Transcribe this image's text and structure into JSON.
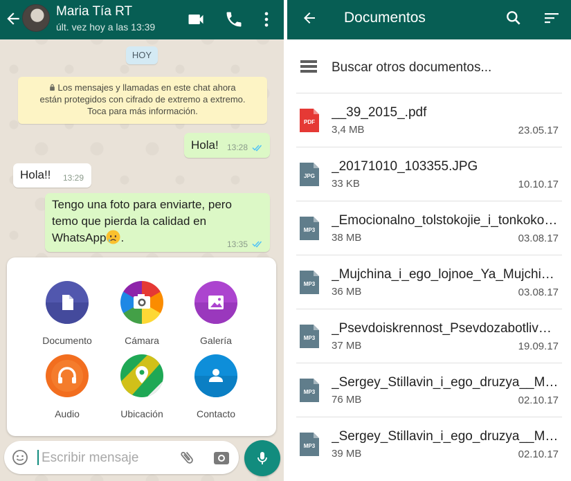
{
  "chat": {
    "contact_name": "Maria Tía RT",
    "last_seen": "últ. vez hoy a las 13:39",
    "day_chip": "HOY",
    "encryption_notice_lines": [
      "Los mensajes y llamadas en este chat ahora",
      "están protegidos con cifrado de extremo a extremo.",
      "Toca para más información."
    ],
    "messages": [
      {
        "direction": "out",
        "lines": [
          "Hola!"
        ],
        "time": "13:28",
        "status": "read"
      },
      {
        "direction": "in",
        "lines": [
          "Hola!!"
        ],
        "time": "13:29"
      },
      {
        "direction": "out",
        "lines": [
          "Tengo una foto para enviarte,  pero",
          "temo que pierda la calidad en",
          "WhatsApp"
        ],
        "emoji": "sad-face",
        "trailing": ".",
        "time": "13:35",
        "status": "read"
      }
    ],
    "attach_menu": [
      {
        "label": "Documento",
        "icon": "document-icon",
        "color": "#5157ae"
      },
      {
        "label": "Cámara",
        "icon": "camera-icon",
        "color": "#d3396d"
      },
      {
        "label": "Galería",
        "icon": "gallery-icon",
        "color": "#ac44cf"
      },
      {
        "label": "Audio",
        "icon": "headphones-icon",
        "color": "#f26e1f"
      },
      {
        "label": "Ubicación",
        "icon": "location-icon",
        "color": "#1fa855"
      },
      {
        "label": "Contacto",
        "icon": "contact-icon",
        "color": "#0e8ed9"
      }
    ],
    "composer_placeholder": "Escribir mensaje"
  },
  "documents": {
    "title": "Documentos",
    "browse_label": "Buscar otros documentos...",
    "files": [
      {
        "name": "__39_2015_.pdf",
        "size": "3,4 MB",
        "date": "23.05.17",
        "type": "PDF"
      },
      {
        "name": "_20171010_103355.JPG",
        "size": "33 KB",
        "date": "10.10.17",
        "type": "JPG"
      },
      {
        "name": "_Emocionalno_tolstokojie_i_tonkoko…",
        "size": "38 MB",
        "date": "03.08.17",
        "type": "MP3"
      },
      {
        "name": "_Mujchina_i_ego_lojnoe_Ya_Mujchi…",
        "size": "36 MB",
        "date": "03.08.17",
        "type": "MP3"
      },
      {
        "name": "_Psevdoiskrennost_Psevdozabotliv…",
        "size": "37 MB",
        "date": "19.09.17",
        "type": "MP3"
      },
      {
        "name": "_Sergey_Stillavin_i_ego_druzya__Mu…",
        "size": "76 MB",
        "date": "02.10.17",
        "type": "MP3"
      },
      {
        "name": "_Sergey_Stillavin_i_ego_druzya__Mu…",
        "size": "39 MB",
        "date": "02.10.17",
        "type": "MP3"
      }
    ]
  },
  "colors": {
    "header": "#075e54",
    "accent": "#128c7e",
    "outgoing_bubble": "#dcf8c6",
    "pdf_icon": "#e53935",
    "file_icon": "#607d8b"
  }
}
